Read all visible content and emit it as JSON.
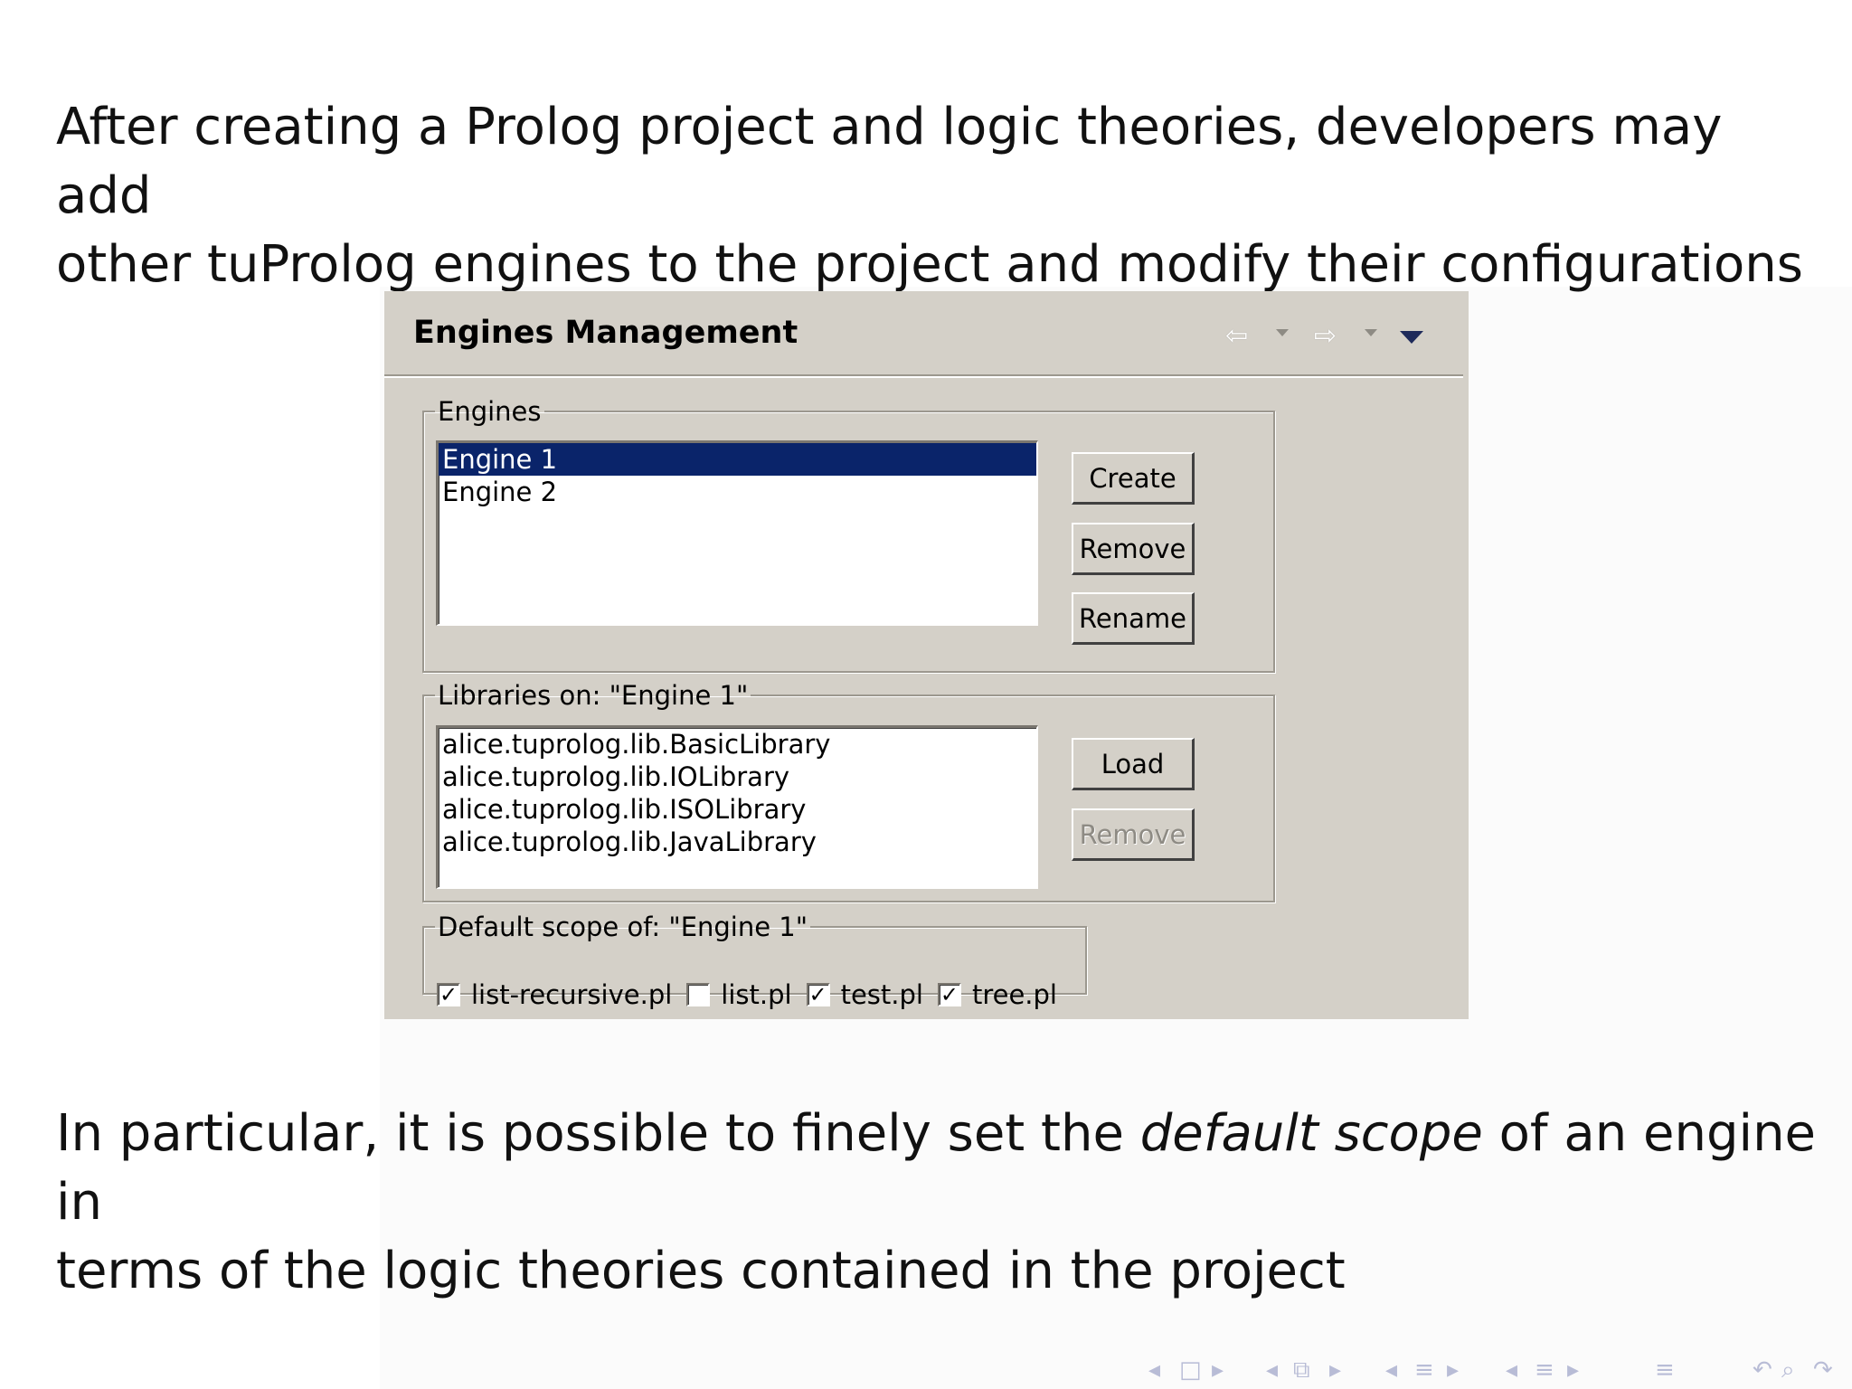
{
  "paragraphs": {
    "intro_line1": "After creating a Prolog project and logic theories, developers may add",
    "intro_line2": "other tuProlog engines to the project and modify their configurations",
    "outro_pre": "In particular, it is possible to finely set the ",
    "outro_em": "default scope",
    "outro_post": " of an engine in",
    "outro_line2": "terms of the logic theories contained in the project"
  },
  "dialog": {
    "title": "Engines Management",
    "toolbar_icons": [
      "back-arrow-icon",
      "forward-arrow-icon",
      "view-menu-icon"
    ],
    "engines_group": {
      "label": "Engines",
      "items": [
        "Engine 1",
        "Engine 2"
      ],
      "selected": "Engine 1",
      "buttons": {
        "create": "Create",
        "remove": "Remove",
        "rename": "Rename"
      }
    },
    "libraries_group": {
      "label": "Libraries on: \"Engine 1\"",
      "items": [
        "alice.tuprolog.lib.BasicLibrary",
        "alice.tuprolog.lib.IOLibrary",
        "alice.tuprolog.lib.ISOLibrary",
        "alice.tuprolog.lib.JavaLibrary"
      ],
      "buttons": {
        "load": "Load",
        "remove": "Remove"
      },
      "remove_enabled": false
    },
    "scope_group": {
      "label": "Default scope of: \"Engine 1\"",
      "files": [
        {
          "name": "list-recursive.pl",
          "checked": true
        },
        {
          "name": "list.pl",
          "checked": false
        },
        {
          "name": "test.pl",
          "checked": true
        },
        {
          "name": "tree.pl",
          "checked": true
        }
      ]
    }
  },
  "colors": {
    "dialog_bg": "#d4d0c8",
    "selection_bg": "#0a246a",
    "selection_fg": "#ffffff"
  },
  "navigation_icons": [
    "frame-prev-icon",
    "frame-icon",
    "frame-next-icon",
    "subsection-prev-icon",
    "subsection-icon",
    "subsection-next-icon",
    "section-prev-icon",
    "section-icon",
    "section-next-icon",
    "chapter-prev-icon",
    "chapter-icon",
    "chapter-next-icon",
    "toc-icon",
    "back-icon",
    "search-icon",
    "forward-icon"
  ]
}
